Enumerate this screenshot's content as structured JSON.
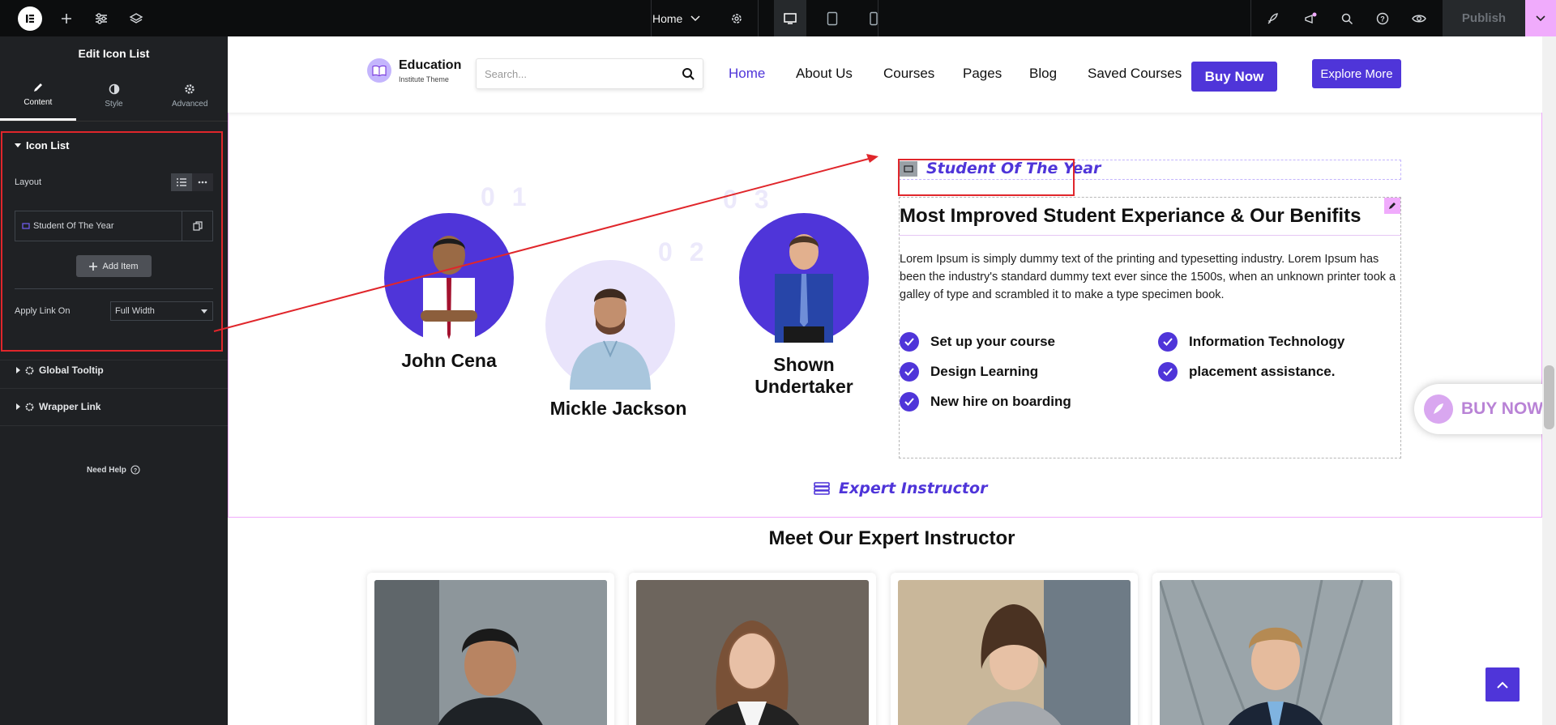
{
  "topbar": {
    "page_name": "Home",
    "publish_label": "Publish"
  },
  "panel": {
    "title": "Edit Icon List",
    "tabs": [
      {
        "label": "Content",
        "icon": "pencil-icon"
      },
      {
        "label": "Style",
        "icon": "half-circle-icon"
      },
      {
        "label": "Advanced",
        "icon": "gear-icon"
      }
    ],
    "section_title": "Icon List",
    "layout_label": "Layout",
    "item_label": "Student Of The Year",
    "add_item_label": "Add Item",
    "apply_link_label": "Apply Link On",
    "apply_link_value": "Full Width",
    "global_tooltip": "Global Tooltip",
    "wrapper_link": "Wrapper Link",
    "need_help": "Need Help"
  },
  "site": {
    "brand_name": "Education",
    "brand_sub": "Institute Theme",
    "search_placeholder": "Search...",
    "nav": [
      "Home",
      "About Us",
      "Courses",
      "Pages",
      "Blog",
      "Saved Courses"
    ],
    "buy_now": "Buy Now",
    "explore_more": "Explore More"
  },
  "students": {
    "numbers": [
      "0 1",
      "0 2",
      "0 3"
    ],
    "names": [
      "John Cena",
      "Mickle Jackson",
      "Shown Undertaker"
    ]
  },
  "feature": {
    "tag": "Student Of The Year",
    "heading": "Most Improved Student Experiance & Our Benifits",
    "body": "Lorem Ipsum is simply dummy text of the printing and typesetting industry. Lorem Ipsum has been the industry's standard dummy text ever since the 1500s, when an unknown printer took a galley of type and scrambled it to make a type specimen book.",
    "list": [
      "Set up your course",
      "Information Technology",
      "Design Learning",
      "placement assistance.",
      "New hire on boarding"
    ]
  },
  "float_buy": "BUY NOW",
  "instructors": {
    "tag": "Expert Instructor",
    "heading": "Meet Our Expert Instructor"
  },
  "colors": {
    "accent": "#4f35d9",
    "highlight": "#e0262b",
    "editor_pink": "#f0abfc"
  }
}
